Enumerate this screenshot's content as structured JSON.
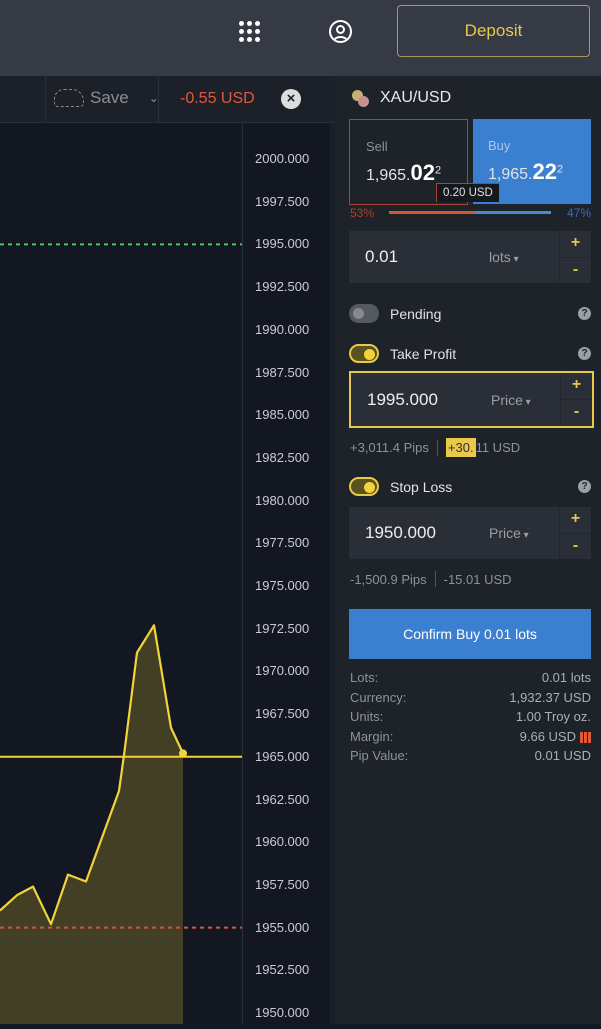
{
  "header": {
    "apps_icon": "grid-icon",
    "account_icon": "user-circle-icon",
    "deposit_label": "Deposit"
  },
  "toolbar": {
    "save_label": "Save",
    "pnl": "-0.55 USD",
    "close_icon": "close-circle-icon"
  },
  "chart": {
    "price_axis": [
      "2000.000",
      "1997.500",
      "1995.000",
      "1992.500",
      "1990.000",
      "1987.500",
      "1985.000",
      "1982.500",
      "1980.000",
      "1977.500",
      "1975.000",
      "1972.500",
      "1970.000",
      "1967.500",
      "1965.000",
      "1962.500",
      "1960.000",
      "1957.500",
      "1955.000",
      "1952.500",
      "1950.000"
    ],
    "ylim": [
      1950,
      2000
    ],
    "prices": [
      1956.0,
      1956.9,
      1957.4,
      1955.2,
      1958.1,
      1957.7,
      1963.0,
      1965.1,
      1971.1,
      1972.7,
      1966.7,
      1965.2
    ],
    "current_price": 1965.0,
    "take_profit_level": 1995.0,
    "stop_loss_level": 1955.0,
    "colors": {
      "line": "#f2d43a",
      "tp": "#3ecf5a",
      "sl": "#d9553a"
    }
  },
  "panel": {
    "symbol": "XAU/USD",
    "sell": {
      "label": "Sell",
      "price_main": "1,965.",
      "price_big": "02",
      "price_sup": "2"
    },
    "buy": {
      "label": "Buy",
      "price_main": "1,965.",
      "price_big": "22",
      "price_sup": "2"
    },
    "spread": "0.20 USD",
    "sell_pct": "53%",
    "buy_pct": "47%",
    "sell_ratio": 0.53,
    "volume": {
      "value": "0.01",
      "unit": "lots"
    },
    "pending": {
      "label": "Pending",
      "on": false
    },
    "take_profit": {
      "label": "Take Profit",
      "on": true,
      "value": "1995.000",
      "unit": "Price",
      "pips": "+3,011.4 Pips",
      "usd_hl": "+30.",
      "usd_rest": "11 USD"
    },
    "stop_loss": {
      "label": "Stop Loss",
      "on": true,
      "value": "1950.000",
      "unit": "Price",
      "pips": "-1,500.9 Pips",
      "usd": "-15.01 USD"
    },
    "confirm_label": "Confirm Buy 0.01 lots",
    "summary": [
      {
        "label": "Lots:",
        "value": "0.01 lots"
      },
      {
        "label": "Currency:",
        "value": "1,932.37 USD"
      },
      {
        "label": "Units:",
        "value": "1.00 Troy oz."
      },
      {
        "label": "Margin:",
        "value": "9.66 USD"
      },
      {
        "label": "Pip Value:",
        "value": "0.01 USD"
      }
    ],
    "colors": {
      "accent": "#e8c94a",
      "buy": "#3a7fd0",
      "sell": "#a8452f"
    }
  }
}
